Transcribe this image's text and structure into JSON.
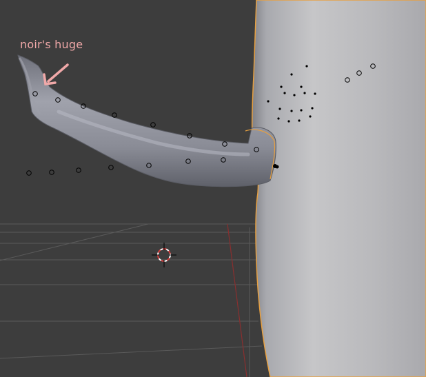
{
  "annotation": {
    "text": "noir's huge",
    "color": "#f0a8a8"
  },
  "colors": {
    "background": "#3d3d3d",
    "grid_line": "#5a5a5a",
    "x_axis": "#8a2f2f",
    "selection_outline": "#e8a040",
    "body_mesh": "#b4b4b8",
    "tube_mesh": "#8c8e98",
    "vertex_marker": "#000000"
  },
  "icons": {
    "cursor": "3d-cursor-icon",
    "arrow": "annotation-arrow-icon"
  }
}
